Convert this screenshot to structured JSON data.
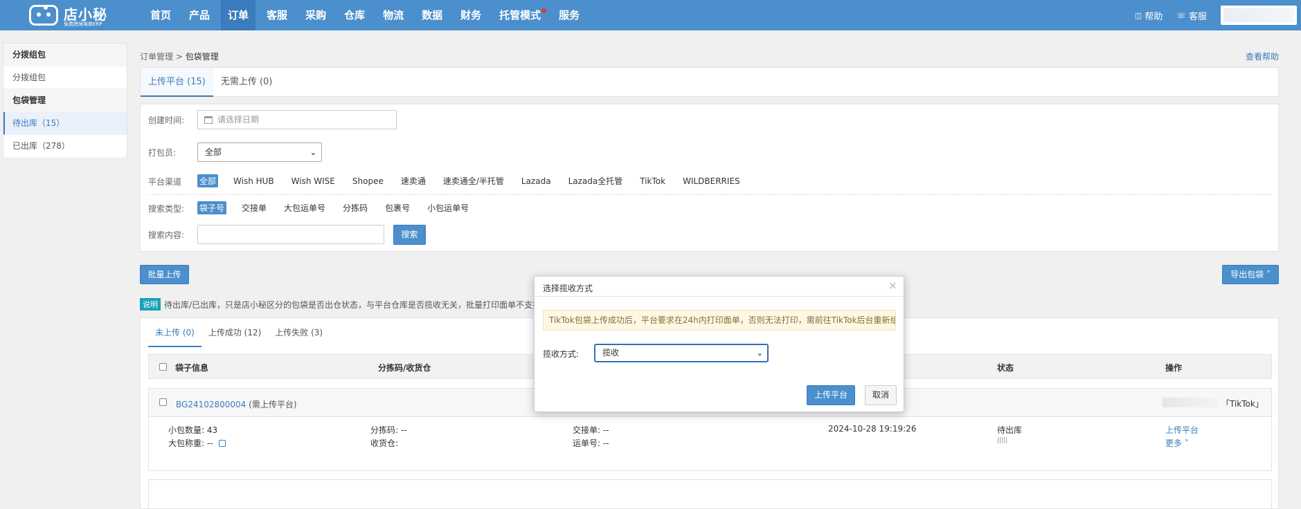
{
  "logo": {
    "title": "店小秘",
    "subtitle": "免费跨境电商ERP"
  },
  "nav": {
    "items": [
      "首页",
      "产品",
      "订单",
      "客服",
      "采购",
      "仓库",
      "物流",
      "数据",
      "财务",
      "托管模式",
      "服务"
    ],
    "active": "订单"
  },
  "top_right": {
    "help": "帮助",
    "service": "客服"
  },
  "sidebar": {
    "group1": "分拨组包",
    "item1": "分拨组包",
    "group2": "包袋管理",
    "item_pending": "待出库（15）",
    "item_shipped": "已出库（278）"
  },
  "breadcrumb": {
    "parent": "订单管理",
    "separator": ">",
    "current": "包袋管理"
  },
  "help_link": "查看帮助",
  "top_tabs": {
    "upload": "上传平台 (15)",
    "no_upload": "无需上传 (0)"
  },
  "filter": {
    "created_label": "创建时间:",
    "date_placeholder": "请选择日期",
    "packer_label": "打包员:",
    "packer_value": "全部",
    "channel_label": "平台渠道",
    "channels": [
      "全部",
      "Wish HUB",
      "Wish WISE",
      "Shopee",
      "速卖通",
      "速卖通全/半托管",
      "Lazada",
      "Lazada全托管",
      "TikTok",
      "WILDBERRIES"
    ],
    "search_type_label": "搜索类型:",
    "search_types": [
      "袋子号",
      "交接单",
      "大包运单号",
      "分拣码",
      "包裹号",
      "小包运单号"
    ],
    "search_content_label": "搜索内容:",
    "search_btn": "搜索"
  },
  "actions": {
    "batch_upload": "批量上传",
    "export": "导出包袋"
  },
  "note": {
    "badge": "说明",
    "text": "待出库/已出库，只是店小秘区分的包袋是否出仓状态，与平台仓库是否揽收无关，批量打印面单不支持速"
  },
  "sub_tabs": {
    "not_uploaded": "未上传 (0)",
    "success": "上传成功 (12)",
    "failed": "上传失败 (3)"
  },
  "table": {
    "headers": {
      "bag_info": "袋子信息",
      "sort_code": "分拣码/收货仓",
      "status": "状态",
      "action": "操作"
    },
    "row": {
      "bag_no": "BG24102800004",
      "bag_note": "(需上传平台)",
      "platform": "「TikTok」",
      "small_count_label": "小包数量:",
      "small_count": "43",
      "weight_label": "大包称重:",
      "weight": "--",
      "sort_code_label": "分拣码:",
      "sort_code": "--",
      "warehouse_label": "收货仓:",
      "handover_label": "交接单:",
      "handover": "--",
      "waybill_label": "运单号:",
      "waybill": "--",
      "time": "2024-10-28 19:19:26",
      "status": "待出库",
      "barcode": "|||||",
      "action_upload": "上传平台",
      "action_more": "更多"
    }
  },
  "modal": {
    "title": "选择揽收方式",
    "warning": "TikTok包袋上传成功后，平台要求在24h内打印面单，否则无法打印，需前往TikTok后台重新组包",
    "method_label": "揽收方式:",
    "method_value": "揽收",
    "ok": "上传平台",
    "cancel": "取消"
  },
  "colors": {
    "brand": "#4b8fcd",
    "link": "#3a7cbd",
    "warn_bg": "#fcf8e3",
    "badge": "#17a2b8",
    "notify_dot": "#e53935"
  }
}
